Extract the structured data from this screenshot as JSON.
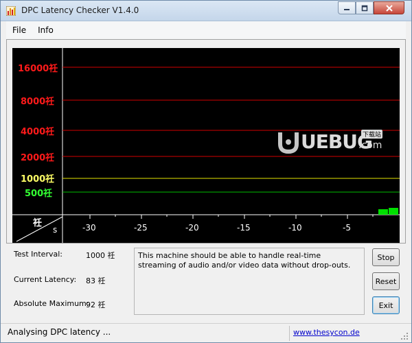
{
  "window": {
    "title": "DPC Latency Checker V1.4.0",
    "min_symbol": "▁",
    "max_symbol": "□",
    "close_symbol": "✕"
  },
  "menu": {
    "file": "File",
    "info": "Info"
  },
  "graph": {
    "y_labels": [
      {
        "text": "16000祍",
        "color": "#ff1a1a"
      },
      {
        "text": "8000祍",
        "color": "#ff1a1a"
      },
      {
        "text": "4000祍",
        "color": "#ff1a1a"
      },
      {
        "text": "2000祍",
        "color": "#ff1a1a"
      },
      {
        "text": "1000祍",
        "color": "#ffff66"
      },
      {
        "text": "500祍",
        "color": "#33ff33"
      }
    ],
    "unit_y": "祍",
    "unit_x": "s",
    "x_ticks": [
      "-30",
      "-25",
      "-20",
      "-15",
      "-10",
      "-5"
    ],
    "watermark_main": "UEBUG",
    "watermark_dot": ".com",
    "watermark_badge": "下载站",
    "colors": {
      "red_line": "#d20000",
      "yellow_line": "#e6e600",
      "green_line": "#00c000",
      "bar": "#00e000"
    }
  },
  "info": {
    "test_interval_label": "Test Interval:",
    "test_interval_value": "1000 祍",
    "current_latency_label": "Current Latency:",
    "current_latency_value": "83 祍",
    "absolute_max_label": "Absolute Maximum:",
    "absolute_max_value": "92 祍",
    "message": "This machine should be able to handle real-time streaming of audio and/or video data without drop-outs."
  },
  "buttons": {
    "stop": "Stop",
    "reset": "Reset",
    "exit": "Exit"
  },
  "status": {
    "text": "Analysing DPC latency ...",
    "link": "www.thesycon.de"
  }
}
